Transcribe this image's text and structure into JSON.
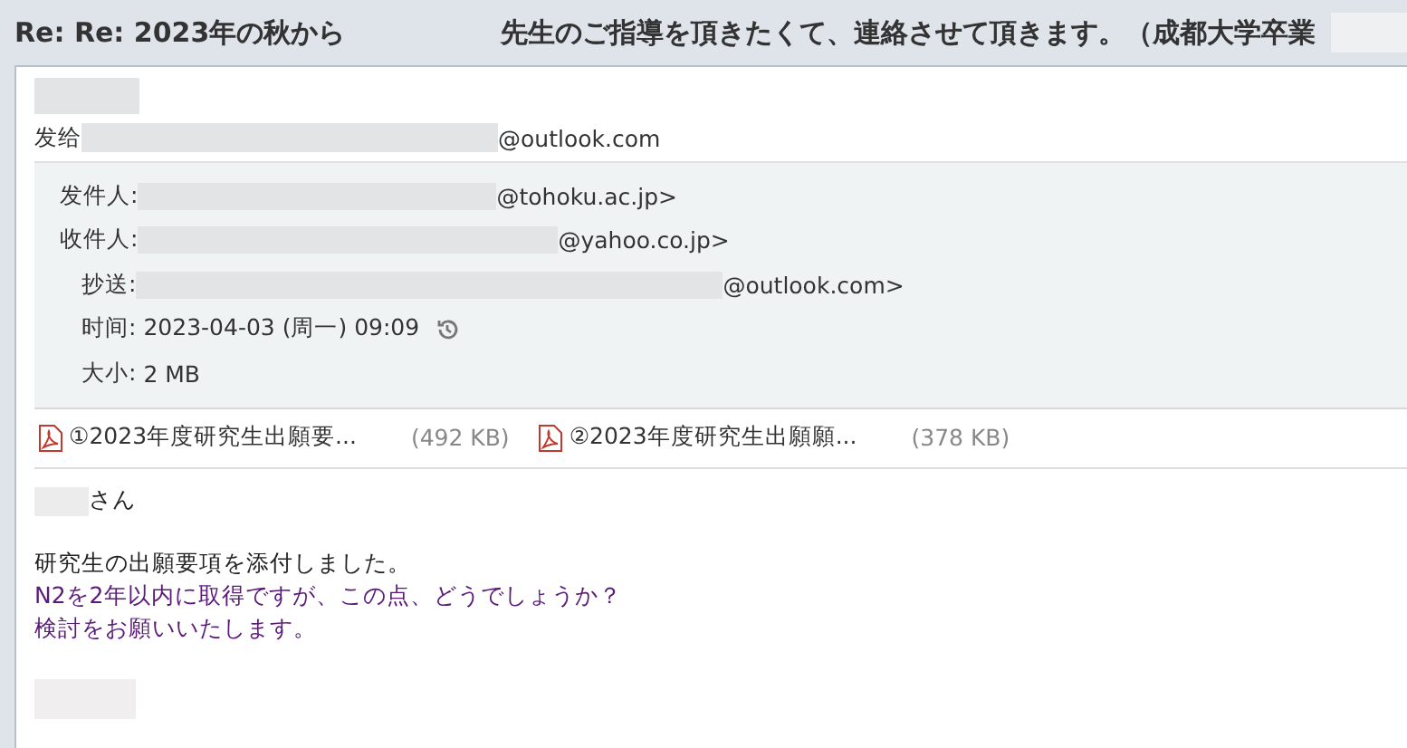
{
  "subject": {
    "before": "Re: Re: 2023年の秋から",
    "after": "先生のご指導を頂きたくて、連絡させて頂きます。（成都大学卒業"
  },
  "sent_to": {
    "label": "发给",
    "domain": "@outlook.com"
  },
  "header_fields": [
    {
      "label": "发件人:",
      "value": "@tohoku.ac.jp>",
      "redacted": true,
      "kind": "address"
    },
    {
      "label": "收件人:",
      "value": "@yahoo.co.jp>",
      "redacted": true,
      "kind": "address"
    },
    {
      "label": "抄送:",
      "value": "@outlook.com>",
      "redacted": true,
      "kind": "address"
    },
    {
      "label": "时间:",
      "value": "2023-04-03 (周一) 09:09",
      "redacted": false,
      "kind": "time"
    },
    {
      "label": "大小:",
      "value": "2 MB",
      "redacted": false,
      "kind": "plain"
    }
  ],
  "attachments": [
    {
      "name": "①2023年度研究生出願要...",
      "size": "(492 KB)"
    },
    {
      "name": "②2023年度研究生出願願...",
      "size": "(378 KB)"
    }
  ],
  "greeting": "さん",
  "body_lines": [
    {
      "text": "研究生の出願要項を添付しました。",
      "color": "#222222"
    },
    {
      "text": "N2を2年以内に取得ですが、この点、どうでしょうか？",
      "color": "#5a1a78"
    },
    {
      "text": "検討をお願いいたします。",
      "color": "#5a1a78"
    }
  ]
}
